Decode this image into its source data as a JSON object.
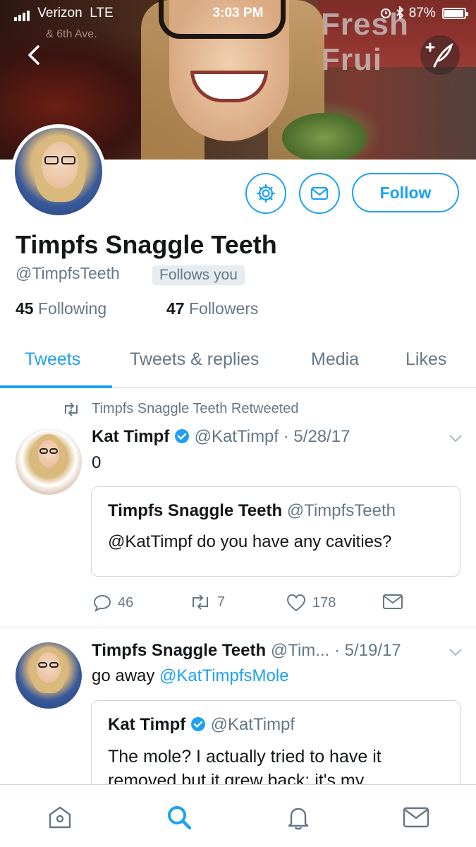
{
  "status_bar": {
    "carrier": "Verizon",
    "network": "LTE",
    "time": "3:03 PM",
    "battery": "87%"
  },
  "banner": {
    "sign_text": "Fresh Frui",
    "street_text": "& 6th Ave."
  },
  "profile": {
    "name": "Timpfs Snaggle Teeth",
    "handle": "@TimpfsTeeth",
    "follows_you": "Follows you",
    "following_count": "45",
    "following_label": "Following",
    "followers_count": "47",
    "followers_label": "Followers",
    "follow_label": "Follow"
  },
  "tabs": [
    {
      "label": "Tweets",
      "active": true
    },
    {
      "label": "Tweets & replies",
      "active": false
    },
    {
      "label": "Media",
      "active": false
    },
    {
      "label": "Likes",
      "active": false
    }
  ],
  "tweets": [
    {
      "retweet_label": "Timpfs Snaggle Teeth Retweeted",
      "author_name": "Kat Timpf",
      "verified": true,
      "author_handle": "@KatTimpf",
      "separator": "·",
      "date": "5/28/17",
      "text": "0",
      "quote": {
        "author_name": "Timpfs Snaggle Teeth",
        "author_handle": "@TimpfsTeeth",
        "text": "@KatTimpf do you have any cavities?"
      },
      "replies": "46",
      "retweets": "7",
      "likes": "178"
    },
    {
      "author_name": "Timpfs Snaggle Teeth",
      "author_handle": "@Tim...",
      "separator": "·",
      "date": "5/19/17",
      "text_prefix": "go away ",
      "mention": "@KatTimpfsMole",
      "quote": {
        "author_name": "Kat Timpf",
        "verified": true,
        "author_handle": "@KatTimpf",
        "text": "The mole? I actually tried to have it removed but it grew back; it's my"
      }
    }
  ],
  "colors": {
    "accent": "#1da1f2",
    "text": "#14171a",
    "muted": "#657786",
    "border": "#ccd6dd"
  },
  "icons": [
    "back-icon",
    "compose-icon",
    "gear-icon",
    "envelope-icon",
    "retweet-icon",
    "verified-icon",
    "chevron-down-icon",
    "reply-icon",
    "heart-icon",
    "home-icon",
    "search-icon",
    "bell-icon"
  ]
}
